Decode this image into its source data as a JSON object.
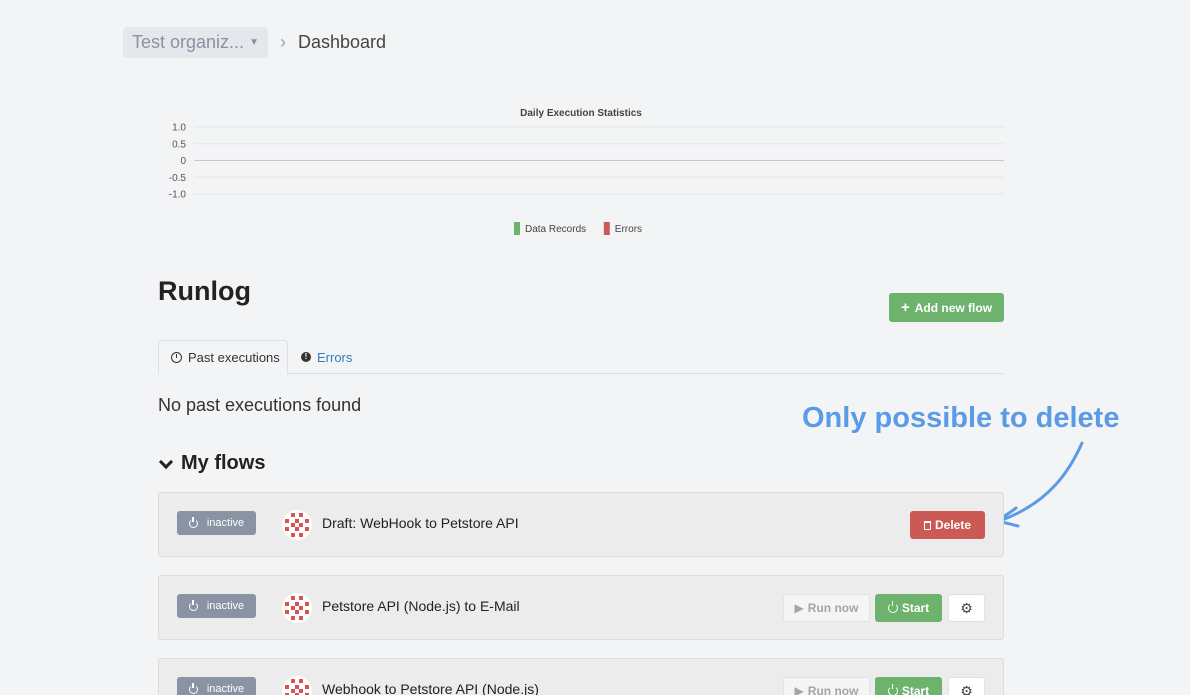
{
  "breadcrumb": {
    "org_label": "Test organiz...",
    "current_page": "Dashboard"
  },
  "chart_data": {
    "type": "bar",
    "title": "Daily Execution Statistics",
    "categories": [],
    "series": [
      {
        "name": "Data Records",
        "values": [],
        "color": "#6db36d"
      },
      {
        "name": "Errors",
        "values": [],
        "color": "#cc5a54"
      }
    ],
    "yticks": [
      "1.0",
      "0.5",
      "0",
      "-0.5",
      "-1.0"
    ],
    "ylim": [
      -1.0,
      1.0
    ],
    "grid": true,
    "legend": "bottom-center"
  },
  "runlog": {
    "title": "Runlog",
    "add_flow_label": "Add new flow",
    "tabs": [
      {
        "label": "Past executions",
        "icon": "clock-icon",
        "active": true
      },
      {
        "label": "Errors",
        "icon": "alert-icon",
        "active": false
      }
    ],
    "empty_message": "No past executions found"
  },
  "annotation": "Only possible to delete",
  "flows": {
    "heading": "My flows",
    "items": [
      {
        "status": "inactive",
        "name": "Draft: WebHook to Petstore API",
        "actions": [
          "Delete"
        ]
      },
      {
        "status": "inactive",
        "name": "Petstore API (Node.js) to E-Mail",
        "actions": [
          "Run now",
          "Start",
          "settings"
        ]
      },
      {
        "status": "inactive",
        "name": "Webhook to Petstore API (Node.js)",
        "actions": [
          "Run now",
          "Start",
          "settings"
        ]
      }
    ],
    "labels": {
      "delete": "Delete",
      "run_now": "Run now",
      "start": "Start"
    }
  },
  "colors": {
    "success": "#6db36d",
    "danger": "#cc5a54",
    "status": "#8993a4",
    "annotation": "#5b9be6",
    "link": "#337ab7"
  }
}
